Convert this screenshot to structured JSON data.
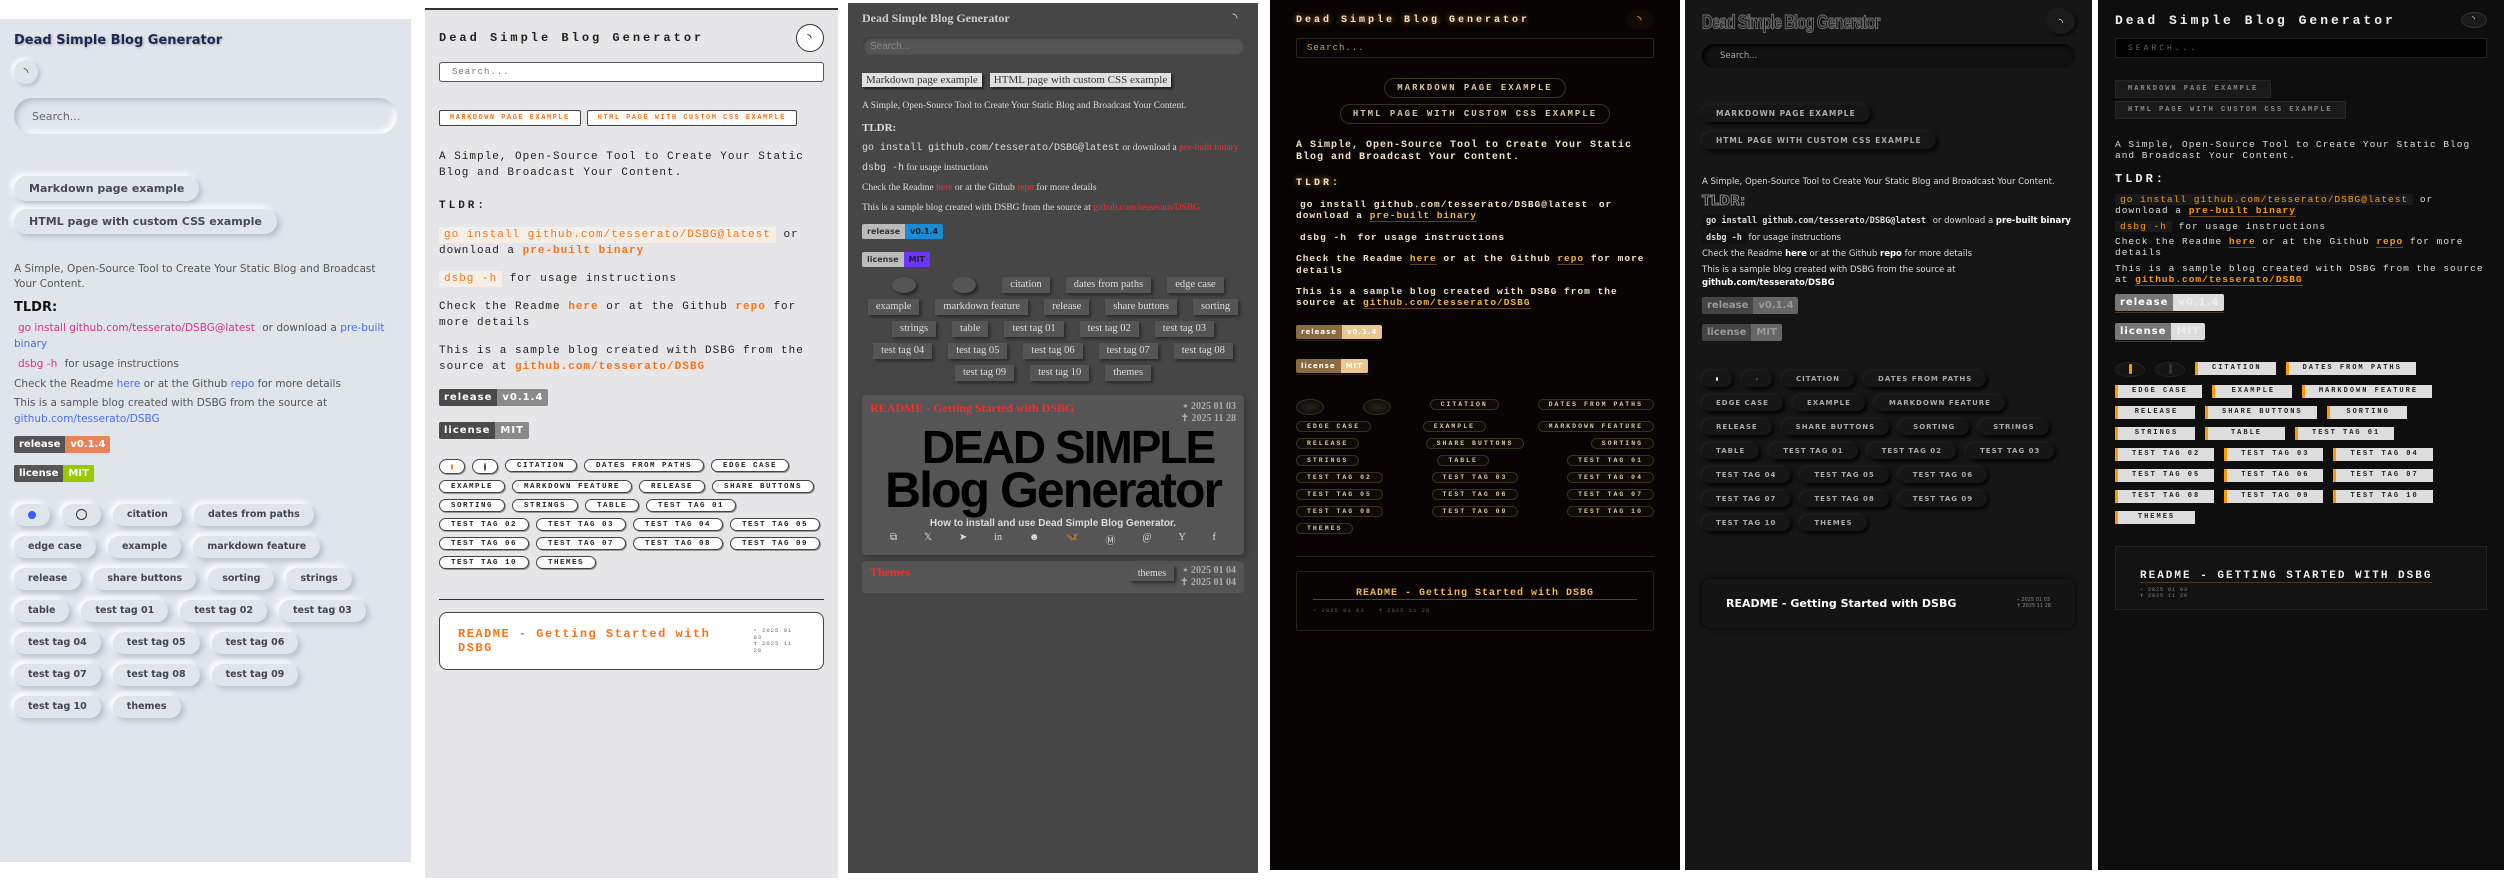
{
  "content": {
    "site_title": "Dead Simple Blog Generator",
    "search_placeholder": "Search...",
    "nav_buttons": [
      "Markdown page example",
      "HTML page with custom CSS example"
    ],
    "intro": "A Simple, Open-Source Tool to Create Your Static Blog and Broadcast Your Content.",
    "tldr_heading": "TLDR:",
    "install_code": "go install github.com/tesserato/DSBG@latest",
    "install_mid": " or download a ",
    "install_link": "pre-built binary",
    "help_code": "dsbg -h",
    "help_text": " for usage instructions",
    "readme_pre": "Check the Readme ",
    "readme_link": "here",
    "readme_mid": " or at the Github ",
    "repo_link": "repo",
    "readme_post": " for more details",
    "sample_pre": "This is a sample blog created with DSBG from the source at ",
    "sample_link": "github.com/tesserato/DSBG",
    "badges": {
      "release_label": "release",
      "release_value": "v0.1.4",
      "license_label": "license",
      "license_value": "MIT"
    },
    "tags": [
      "citation",
      "dates from paths",
      "edge case",
      "example",
      "markdown feature",
      "release",
      "share buttons",
      "sorting",
      "strings",
      "table",
      "test tag 01",
      "test tag 02",
      "test tag 03",
      "test tag 04",
      "test tag 05",
      "test tag 06",
      "test tag 07",
      "test tag 08",
      "test tag 09",
      "test tag 10",
      "themes"
    ],
    "posts": [
      {
        "title": "README - Getting Started with DSBG",
        "created": "2025 01 03",
        "updated": "2025 11 28",
        "logo_line1": "DEAD SIMPLE",
        "logo_line2": "Blog Generator",
        "description": "How to install and use Dead Simple Blog Generator."
      },
      {
        "title": "Themes",
        "tag": "themes",
        "created": "2025 01 04",
        "updated": "2025 01 04"
      }
    ],
    "date_created_symbol": "⋆",
    "date_updated_symbol": "✝"
  },
  "colors": {
    "neumorphic_link": "#4a6cf7",
    "mono_accent": "#f97316",
    "serif_link": "#ff2a2a",
    "gold_accent": "#f0b848",
    "industrial_accent": "#ff9900"
  }
}
